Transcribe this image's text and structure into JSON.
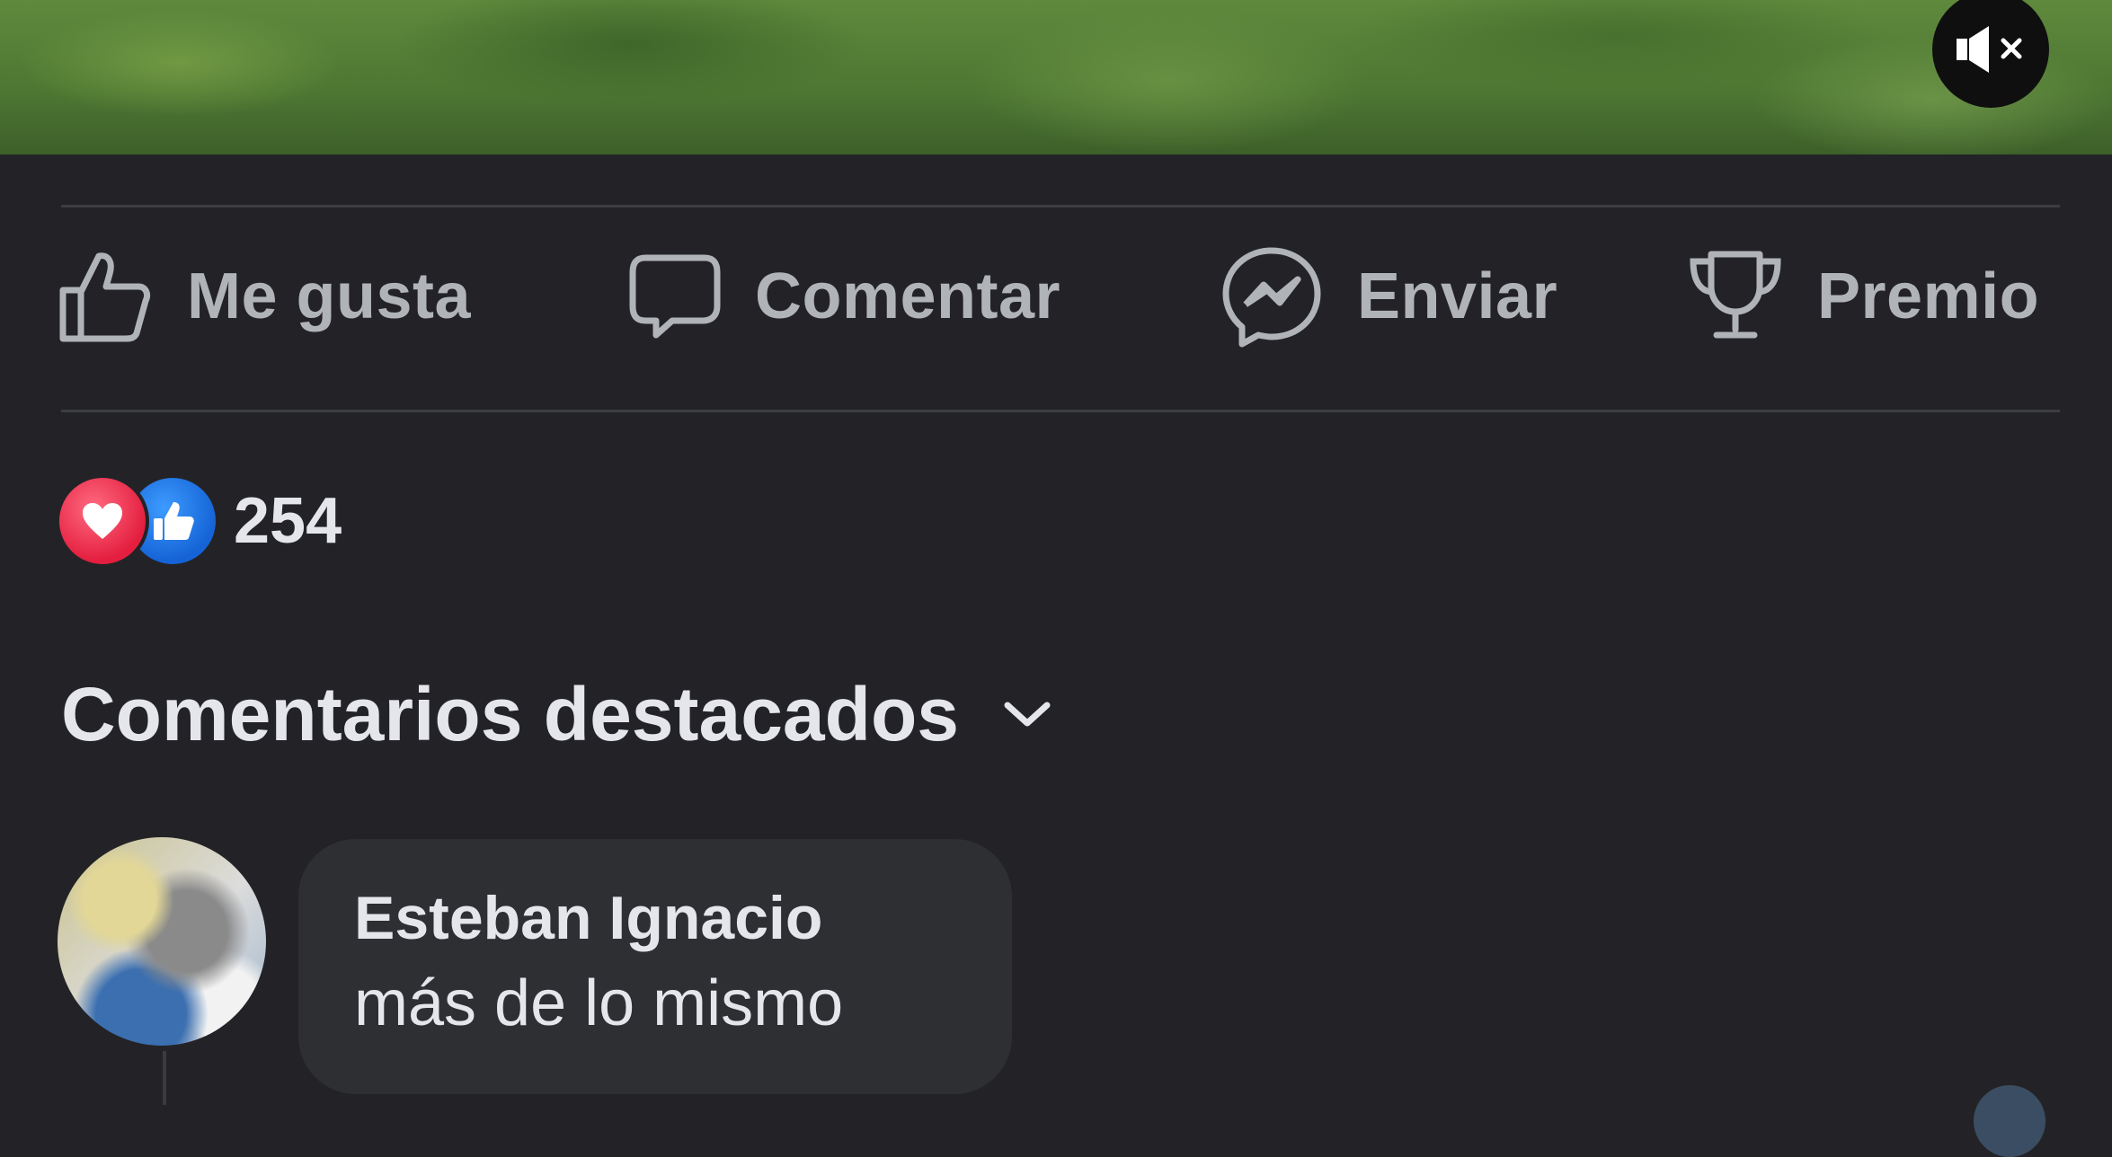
{
  "video": {
    "mute_icon": "speaker-muted-icon"
  },
  "actions": {
    "like": {
      "label": "Me gusta",
      "icon": "thumbs-up-outline-icon"
    },
    "comment": {
      "label": "Comentar",
      "icon": "speech-bubble-icon"
    },
    "send": {
      "label": "Enviar",
      "icon": "messenger-icon"
    },
    "award": {
      "label": "Premio",
      "icon": "trophy-icon"
    }
  },
  "reactions": {
    "types": [
      "love",
      "like"
    ],
    "count": "254",
    "colors": {
      "love": "#e41e3f",
      "like": "#1877f2"
    }
  },
  "comments_section": {
    "sort_label": "Comentarios destacados",
    "sort_icon": "chevron-down-icon",
    "items": [
      {
        "author": "Esteban Ignacio",
        "text": "más de lo mismo"
      }
    ]
  },
  "colors": {
    "background": "#232327",
    "bubble": "#2e2f33",
    "action_text": "#b0b3b8",
    "primary_text": "#e4e6eb"
  }
}
